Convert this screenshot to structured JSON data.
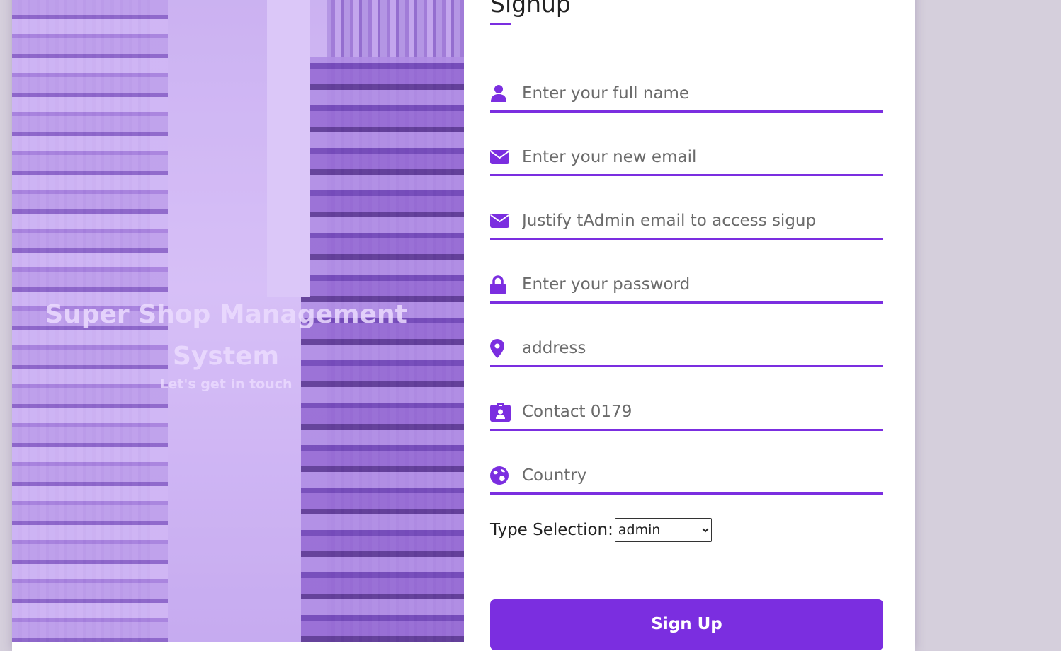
{
  "cover": {
    "title": "Super Shop Management System",
    "subtitle": "Let's get in touch"
  },
  "form": {
    "title": "Signup",
    "fields": [
      {
        "icon": "user-icon",
        "placeholder": "Enter your full name",
        "value": ""
      },
      {
        "icon": "envelope-icon",
        "placeholder": "Enter your new email",
        "value": ""
      },
      {
        "icon": "envelope-icon",
        "placeholder": "Justify tAdmin email to access sigup",
        "value": ""
      },
      {
        "icon": "lock-icon",
        "placeholder": "Enter your password",
        "value": ""
      },
      {
        "icon": "map-pin-icon",
        "placeholder": "address",
        "value": ""
      },
      {
        "icon": "contact-card-icon",
        "placeholder": "Contact 0179",
        "value": ""
      },
      {
        "icon": "globe-icon",
        "placeholder": "Country",
        "value": ""
      }
    ],
    "type_selection": {
      "label": "Type Selection:",
      "selected": "admin"
    },
    "submit_label": "Sign Up"
  },
  "colors": {
    "accent": "#7b2ee0",
    "page_background": "#d5cfdc"
  }
}
